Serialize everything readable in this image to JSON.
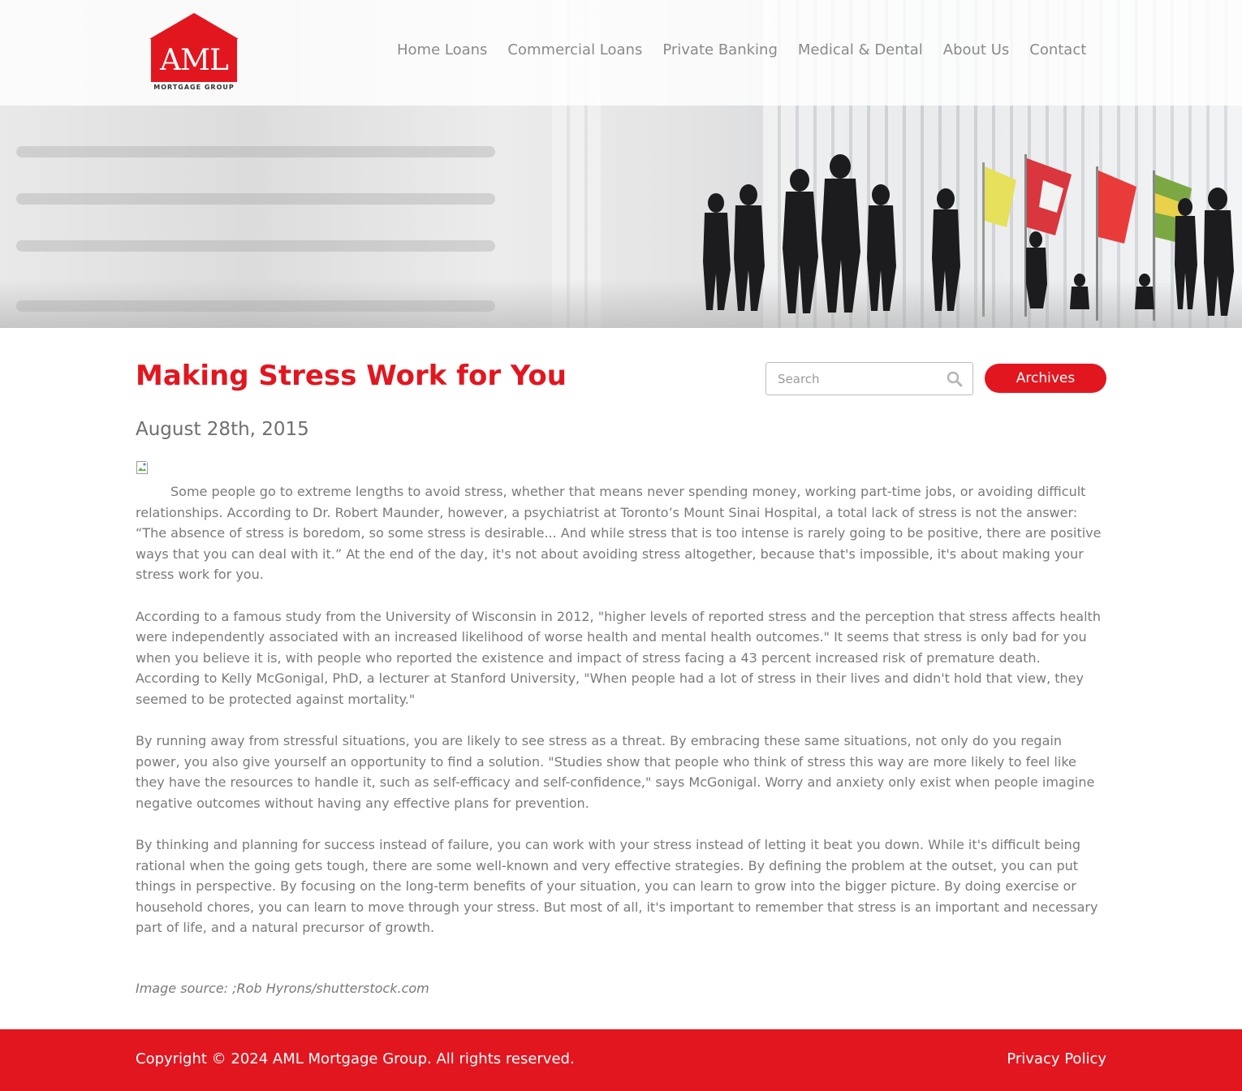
{
  "brand": {
    "logo_text": "AML",
    "logo_subtext": "MORTGAGE GROUP",
    "accent_color": "#e2161f"
  },
  "nav": {
    "items": [
      "Home Loans",
      "Commercial Loans",
      "Private Banking",
      "Medical & Dental",
      "About Us",
      "Contact"
    ]
  },
  "post": {
    "title": "Making Stress Work for You",
    "date": "August 28th, 2015",
    "paragraphs": [
      "Some people go to extreme lengths to avoid stress, whether that means never spending money, working part-time jobs, or avoiding difficult relationships. According to Dr. Robert Maunder, however, a psychiatrist at Toronto’s Mount Sinai Hospital, a total lack of stress is not the answer: “The absence of stress is boredom, so some stress is desirable... And while stress that is too intense is rarely going to be positive, there are positive ways that you can deal with it.” At the end of the day, it's not about avoiding stress altogether, because that's impossible, it's about making your stress work for you.",
      "According to a famous study from the University of Wisconsin in 2012, \"higher levels of reported stress and the perception that stress affects health were independently associated with an increased likelihood of worse health and mental health outcomes.\" It seems that stress is only bad for you when you believe it is, with people who reported the existence and impact of stress facing a 43 percent increased risk of premature death. According to Kelly McGonigal, PhD, a lecturer at Stanford University, \"When people had a lot of stress in their lives and didn't hold that view, they seemed to be protected against mortality.\"",
      "By running away from stressful situations, you are likely to see stress as a threat. By embracing these same situations, not only do you regain power, you also give yourself an opportunity to find a solution. \"Studies show that people who think of stress this way are more likely to feel like they have the resources to handle it, such as self-efficacy and self-confidence,\" says McGonigal. Worry and anxiety only exist when people imagine negative outcomes without having any effective plans for prevention.",
      "By thinking and planning for success instead of failure, you can work with your stress instead of letting it beat you down. While it's difficult being rational when the going gets tough, there are some well-known and very effective strategies. By defining the problem at the outset, you can put things in perspective. By focusing on the long-term benefits of your situation, you can learn to grow into the bigger picture. By doing exercise or household chores, you can learn to move through your stress. But most of all, it's important to remember that stress is an important and necessary part of life, and a natural precursor of growth."
    ],
    "image_credit": "Image source: ;Rob Hyrons/shutterstock.com"
  },
  "sidebar": {
    "search_placeholder": "Search",
    "archives_label": "Archives"
  },
  "footer": {
    "copyright": "Copyright © 2024 AML Mortgage Group. All rights reserved.",
    "privacy_label": "Privacy Policy"
  },
  "icons": {
    "search": "search-icon",
    "broken_image": "broken-image-icon"
  }
}
